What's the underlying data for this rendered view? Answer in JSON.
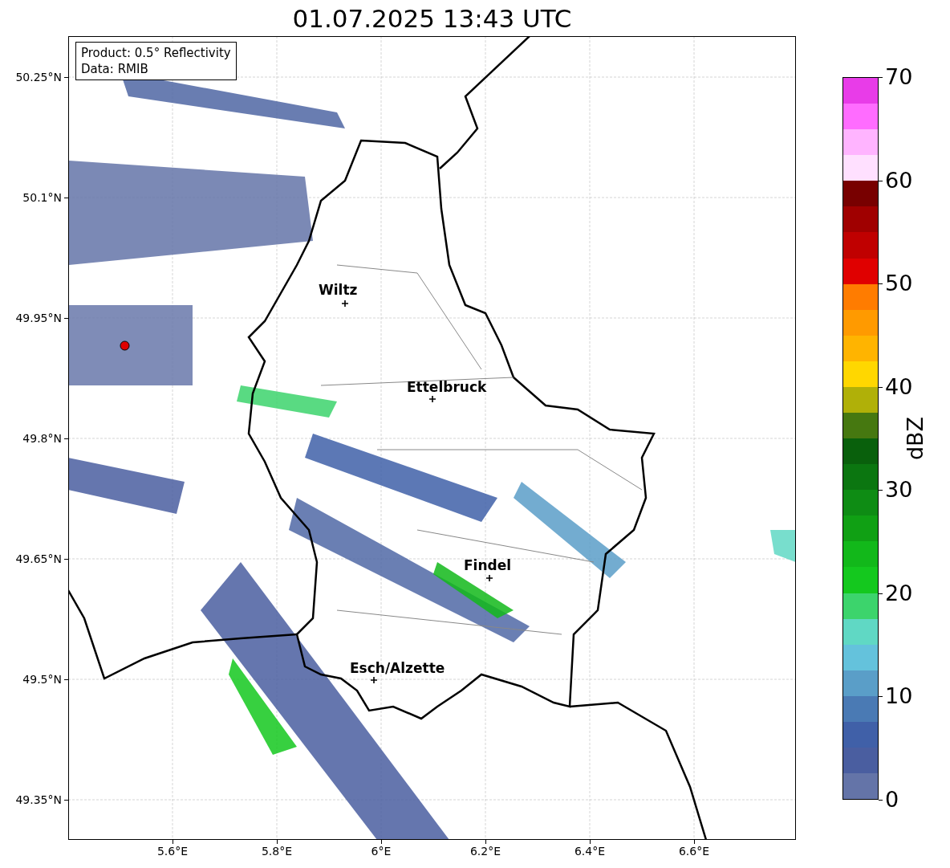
{
  "title": "01.07.2025 13:43 UTC",
  "legend": [
    "Product: 0.5° Reflectivity",
    "Data: RMIB"
  ],
  "y_ticks": [
    "50.25°N",
    "50.1°N",
    "49.95°N",
    "49.8°N",
    "49.65°N",
    "49.5°N",
    "49.35°N"
  ],
  "x_ticks": [
    "5.6°E",
    "5.8°E",
    "6°E",
    "6.2°E",
    "6.4°E",
    "6.6°E"
  ],
  "cities": [
    {
      "name": "Wiltz"
    },
    {
      "name": "Ettelbruck"
    },
    {
      "name": "Findel"
    },
    {
      "name": "Esch/Alzette"
    }
  ],
  "colorbar": {
    "label": "dBZ",
    "ticks": [
      "70",
      "60",
      "50",
      "40",
      "30",
      "20",
      "10",
      "0"
    ],
    "segments": [
      {
        "color": "#e83ce8"
      },
      {
        "color": "#ff6cff"
      },
      {
        "color": "#ffb4ff"
      },
      {
        "color": "#ffe0ff"
      },
      {
        "color": "#780000"
      },
      {
        "color": "#a00000"
      },
      {
        "color": "#c00000"
      },
      {
        "color": "#e00000"
      },
      {
        "color": "#ff7c00"
      },
      {
        "color": "#ff9a00"
      },
      {
        "color": "#ffb400"
      },
      {
        "color": "#ffd700"
      },
      {
        "color": "#b0b008"
      },
      {
        "color": "#467810"
      },
      {
        "color": "#09600c"
      },
      {
        "color": "#0b7610"
      },
      {
        "color": "#0e8c14"
      },
      {
        "color": "#10a014"
      },
      {
        "color": "#12b81a"
      },
      {
        "color": "#14c81e"
      },
      {
        "color": "#3cd46c"
      },
      {
        "color": "#60d8c4"
      },
      {
        "color": "#64c2dc"
      },
      {
        "color": "#5a9ec8"
      },
      {
        "color": "#4a7ab4"
      },
      {
        "color": "#4060a8"
      },
      {
        "color": "#4a5ea0"
      },
      {
        "color": "#6474a8"
      }
    ]
  }
}
